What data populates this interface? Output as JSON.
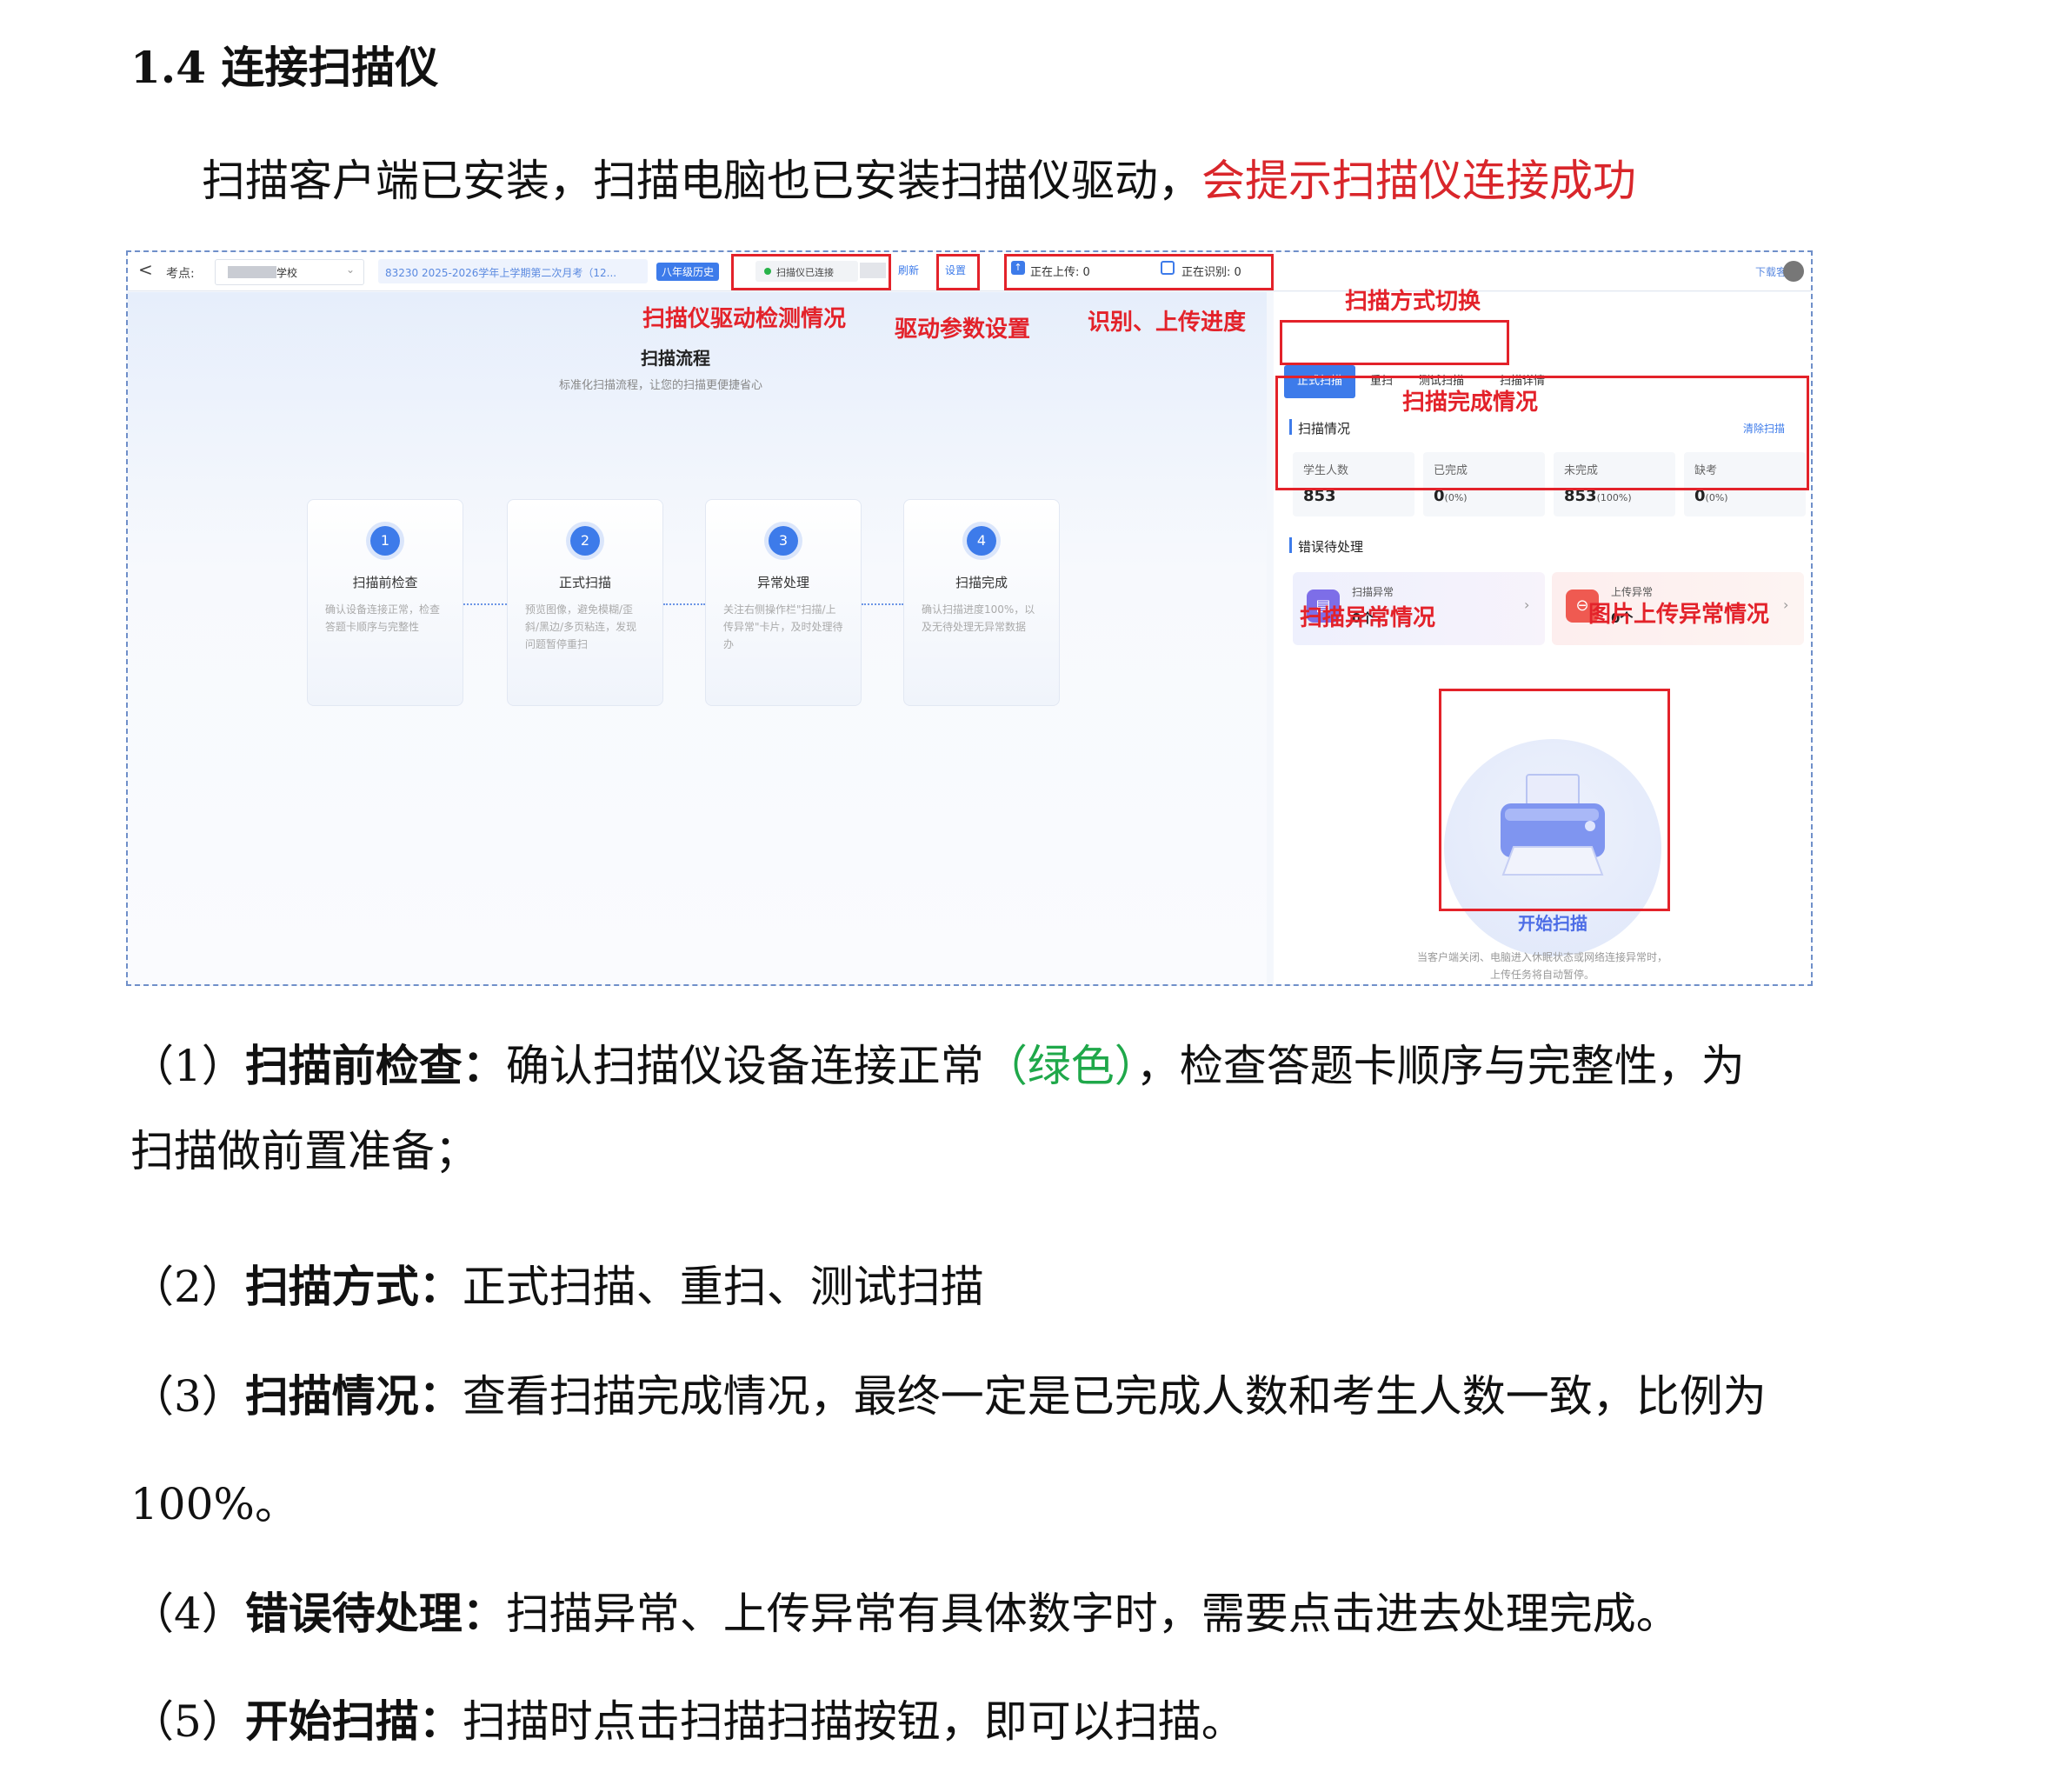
{
  "section": {
    "title": "1.4 连接扫描仪"
  },
  "intro": {
    "normal": "扫描客户端已安装，扫描电脑也已安装扫描仪驱动，",
    "highlight": "会提示扫描仪连接成功"
  },
  "screenshot": {
    "topbar": {
      "back": "<",
      "site_label": "考点:",
      "site_value": "学校",
      "exam_name": "83230 2025-2026学年上学期第二次月考（12...",
      "subject_badge": "八年级历史",
      "scanner_status": "扫描仪已连接",
      "refresh": "刷新",
      "settings": "设置",
      "uploading": "正在上传: 0",
      "recognizing": "正在识别: 0",
      "download": "下载客"
    },
    "flow": {
      "title": "扫描流程",
      "subtitle": "标准化扫描流程，让您的扫描更便捷省心",
      "steps": [
        {
          "num": "1",
          "title": "扫描前检查",
          "desc": "确认设备连接正常，检查答题卡顺序与完整性"
        },
        {
          "num": "2",
          "title": "正式扫描",
          "desc": "预览图像，避免模糊/歪斜/黑边/多页粘连，发现问题暂停重扫"
        },
        {
          "num": "3",
          "title": "异常处理",
          "desc": "关注右侧操作栏\"扫描/上传异常\"卡片，及时处理待办"
        },
        {
          "num": "4",
          "title": "扫描完成",
          "desc": "确认扫描进度100%，以及无待处理无异常数据"
        }
      ]
    },
    "tabs": [
      "正式扫描",
      "重扫",
      "测试扫描",
      "扫描详情"
    ],
    "scan_status": {
      "title": "扫描情况",
      "clear": "清除扫描",
      "items": [
        {
          "label": "学生人数",
          "value": "853",
          "pct": ""
        },
        {
          "label": "已完成",
          "value": "0",
          "pct": "(0%)"
        },
        {
          "label": "未完成",
          "value": "853",
          "pct": "(100%)"
        },
        {
          "label": "缺考",
          "value": "0",
          "pct": "(0%)"
        }
      ]
    },
    "errors": {
      "title": "错误待处理",
      "scan_error": {
        "label": "扫描异常",
        "count": "0个"
      },
      "upload_error": {
        "label": "上传异常",
        "count": "0个"
      }
    },
    "start_button": "开始扫描",
    "footer_note": [
      "当客户端关闭、电脑进入休眠状态或网络连接异常时，",
      "上传任务将自动暂停。"
    ],
    "annotations": {
      "driver_check": "扫描仪驱动检测情况",
      "driver_settings": "驱动参数设置",
      "progress": "识别、上传进度",
      "mode_switch": "扫描方式切换",
      "completion": "扫描完成情况",
      "scan_error": "扫描异常情况",
      "upload_error": "图片上传异常情况"
    }
  },
  "paragraphs": [
    {
      "num": "（1）",
      "bold": "扫描前检查：",
      "text1": "确认扫描仪设备连接正常",
      "green": "（绿色）",
      "text2": "，检查答题卡顺序与完整性，为",
      "cont": "扫描做前置准备；"
    },
    {
      "num": "（2）",
      "bold": "扫描方式：",
      "text": "正式扫描、重扫、测试扫描"
    },
    {
      "num": "（3）",
      "bold": "扫描情况：",
      "text": "查看扫描完成情况，最终一定是已完成人数和考生人数一致，比例为",
      "cont": "100%。"
    },
    {
      "num": "（4）",
      "bold": "错误待处理：",
      "text": "扫描异常、上传异常有具体数字时，需要点击进去处理完成。"
    },
    {
      "num": "（5）",
      "bold": "开始扫描：",
      "text": "扫描时点击扫描扫描按钮，即可以扫描。"
    }
  ]
}
